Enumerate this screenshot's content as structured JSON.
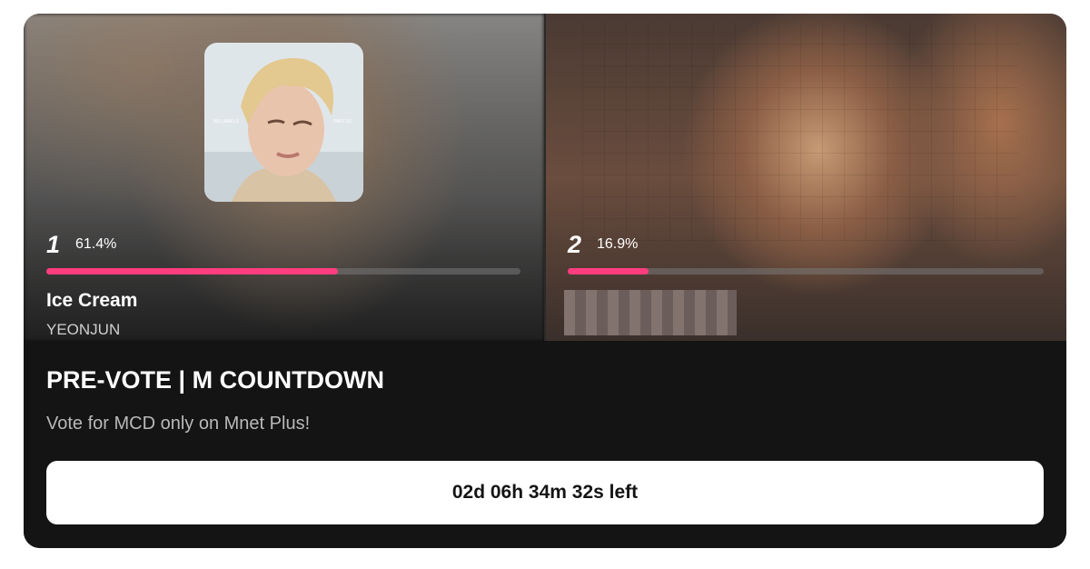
{
  "candidates": [
    {
      "rank": "1",
      "percent": "61.4%",
      "vote_share": 0.614,
      "song": "Ice Cream",
      "artist": "YEONJUN",
      "album_text_left": "NO LABELS",
      "album_text_right": "PART 01"
    },
    {
      "rank": "2",
      "percent": "16.9%",
      "vote_share": 0.169
    }
  ],
  "colors": {
    "accent": "#ff3d7f",
    "card_background": "#141414",
    "track": "#6e6e6e"
  },
  "vote": {
    "title": "PRE-VOTE | M COUNTDOWN",
    "subtitle": "Vote for MCD only on Mnet Plus!",
    "countdown": "02d 06h 34m 32s left"
  }
}
